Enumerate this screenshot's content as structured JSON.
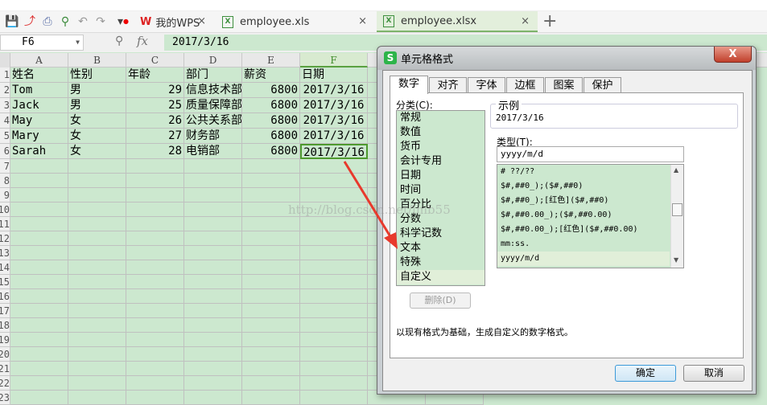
{
  "toolbar": {
    "icons": [
      "save-icon",
      "export-pdf-icon",
      "print-icon",
      "print-preview-icon",
      "undo-icon",
      "redo-icon",
      "customize-icon"
    ]
  },
  "tabs": [
    {
      "label": "我的WPS"
    },
    {
      "label": "employee.xls"
    },
    {
      "label": "employee.xlsx",
      "active": true
    }
  ],
  "formula_bar": {
    "cell_ref": "F6",
    "fx": "fx",
    "value": "2017/3/16"
  },
  "columns": [
    "A",
    "B",
    "C",
    "D",
    "E",
    "F"
  ],
  "rows": [
    [
      "姓名",
      "性别",
      "年龄",
      "部门",
      "薪资",
      "日期"
    ],
    [
      "Tom",
      "男",
      "29",
      "信息技术部",
      "6800",
      "2017/3/16"
    ],
    [
      "Jack",
      "男",
      "25",
      "质量保障部",
      "6800",
      "2017/3/16"
    ],
    [
      "May",
      "女",
      "26",
      "公共关系部",
      "6800",
      "2017/3/16"
    ],
    [
      "Mary",
      "女",
      "27",
      "财务部",
      "6800",
      "2017/3/16"
    ],
    [
      "Sarah",
      "女",
      "28",
      "电销部",
      "6800",
      "2017/3/16"
    ]
  ],
  "row_numbers": [
    "1",
    "2",
    "3",
    "4",
    "5",
    "6",
    "7",
    "8",
    "9",
    "10",
    "11",
    "12",
    "13",
    "14",
    "15",
    "16",
    "17",
    "18",
    "19",
    "20",
    "21",
    "22",
    "23"
  ],
  "dialog": {
    "title": "单元格格式",
    "close": "X",
    "tabs": [
      "数字",
      "对齐",
      "字体",
      "边框",
      "图案",
      "保护"
    ],
    "category_label": "分类(C):",
    "categories": [
      "常规",
      "数值",
      "货币",
      "会计专用",
      "日期",
      "时间",
      "百分比",
      "分数",
      "科学记数",
      "文本",
      "特殊",
      "自定义"
    ],
    "selected_category": "自定义",
    "sample_label": "示例",
    "sample_value": "2017/3/16",
    "type_label": "类型(T):",
    "type_value": "yyyy/m/d",
    "type_list": [
      "# ??/??",
      "$#,##0_);($#,##0)",
      "$#,##0_);[红色]($#,##0)",
      "$#,##0.00_);($#,##0.00)",
      "$#,##0.00_);[红色]($#,##0.00)",
      "mm:ss.",
      "yyyy/m/d"
    ],
    "delete_button": "删除(D)",
    "description": "以现有格式为基础，生成自定义的数字格式。",
    "ok": "确定",
    "cancel": "取消"
  },
  "watermark": "http://blog.csdn.net/lmb55",
  "colors": {
    "sheet_bg": "#cce8cf",
    "accent_green": "#4e9a2e",
    "arrow": "#e8392c"
  }
}
